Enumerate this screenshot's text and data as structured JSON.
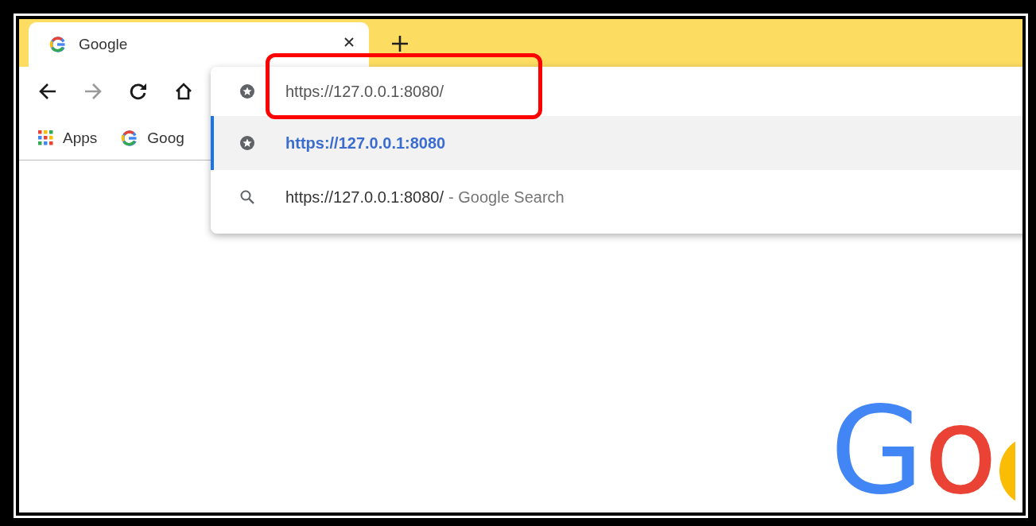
{
  "tabs": [
    {
      "title": "Google",
      "selected": true
    }
  ],
  "toolbar": [
    {
      "kind": "back",
      "disabled": false
    },
    {
      "kind": "forward",
      "disabled": true
    },
    {
      "kind": "reload",
      "disabled": false
    },
    {
      "kind": "home",
      "disabled": false
    }
  ],
  "bookmarks": [
    {
      "kind": "apps",
      "label": "Apps"
    },
    {
      "kind": "site",
      "label": "Goog"
    }
  ],
  "omnibox": {
    "value": "https://127.0.0.1:8080/"
  },
  "suggestions": [
    {
      "kind": "bookmark",
      "text": "https://127.0.0.1:8080",
      "selected": true
    },
    {
      "kind": "search",
      "text": "https://127.0.0.1:8080/",
      "description": "- Google Search",
      "selected": false
    }
  ],
  "logo": [
    {
      "letter": "G",
      "color": "#4285f4"
    },
    {
      "letter": "o",
      "color": "#ea4335"
    }
  ]
}
